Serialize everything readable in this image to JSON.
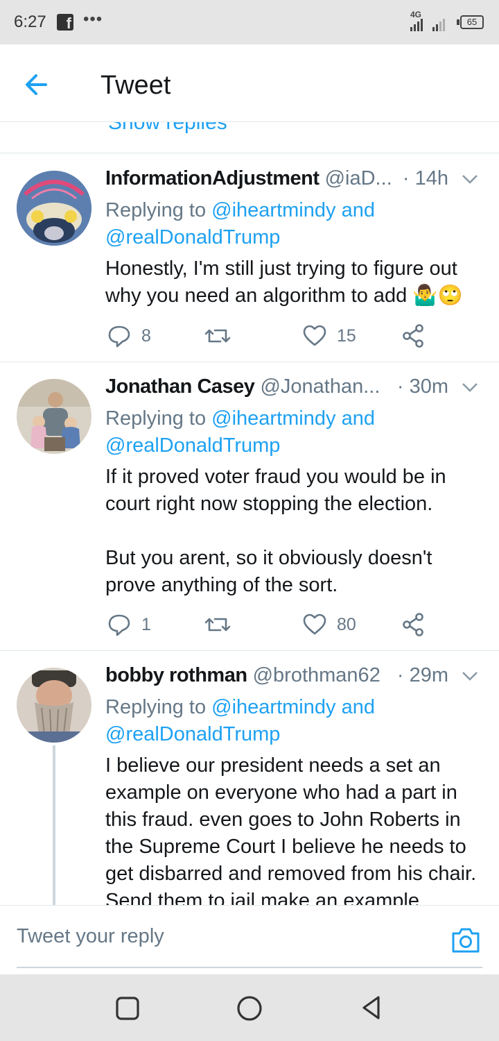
{
  "status_bar": {
    "time": "6:27",
    "network": "4G",
    "battery": "65",
    "more": "•••"
  },
  "header": {
    "title": "Tweet"
  },
  "show_replies": "Show replies",
  "tweets": [
    {
      "name": "InformationAdjustment",
      "handle": "@iaD...",
      "time": "· 14h",
      "replying_prefix": "Replying to",
      "replying_to_1": "@iheartmindy",
      "replying_and": "and",
      "replying_to_2": "@realDonaldTrump",
      "text": "Honestly, I'm still just trying to figure out why you need an algorithm to add 🤷‍♂️🙄",
      "replies": "8",
      "retweets": "",
      "likes": "15"
    },
    {
      "name": "Jonathan Casey",
      "handle": "@Jonathan...",
      "time": "· 30m",
      "replying_prefix": "Replying to",
      "replying_to_1": "@iheartmindy",
      "replying_and": "and",
      "replying_to_2": "@realDonaldTrump",
      "text_p1": "If it proved voter fraud you would be in court right now stopping the election.",
      "text_p2": "But you arent, so it obviously doesn't prove anything of the sort.",
      "replies": "1",
      "retweets": "",
      "likes": "80"
    },
    {
      "name": "bobby rothman",
      "handle": "@brothman62",
      "time": "· 29m",
      "replying_prefix": "Replying to",
      "replying_to_1": "@iheartmindy",
      "replying_and": "and",
      "replying_to_2": "@realDonaldTrump",
      "text": "I believe our president needs a set an example on everyone who had a part in this fraud. even goes to John Roberts in the Supreme Court I believe he needs to get disbarred and removed from his chair. Send them to jail make an example"
    }
  ],
  "composer": {
    "placeholder": "Tweet your reply"
  },
  "colors": {
    "accent": "#1da1f2",
    "muted": "#657786",
    "text": "#14171a",
    "divider": "#e1e8ed"
  }
}
